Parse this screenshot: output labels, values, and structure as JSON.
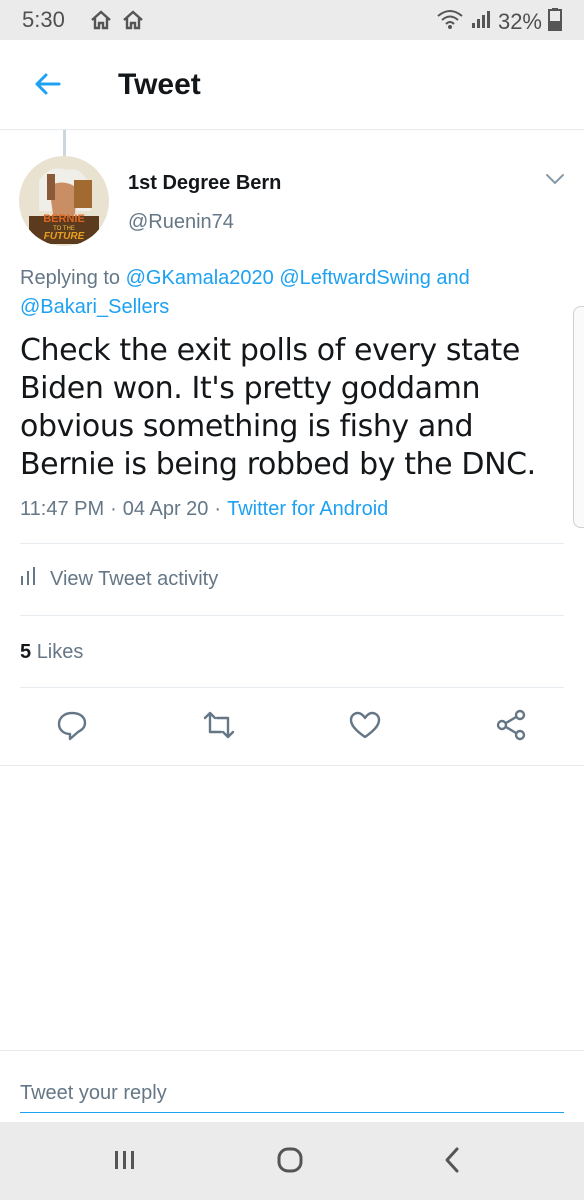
{
  "status_bar": {
    "time": "5:30",
    "battery": "32%",
    "icons": [
      "home-icon",
      "home-icon",
      "wifi-icon",
      "signal-icon",
      "battery-icon"
    ]
  },
  "header": {
    "title": "Tweet",
    "back_icon": "arrow-left-icon"
  },
  "tweet": {
    "author_name": "1st Degree Bern",
    "author_handle": "@Ruenin74",
    "avatar_text": [
      "BERNIE",
      "TO THE",
      "FUTURE"
    ],
    "replying_prefix": "Replying to",
    "replying_to": [
      "@GKamala2020",
      "@LeftwardSwing",
      "@Bakari_Sellers"
    ],
    "replying_and": "and",
    "text": "Check the exit polls of every state Biden won. It's pretty goddamn obvious something is fishy and Bernie is being robbed by the DNC.",
    "time": "11:47 PM",
    "date": "04 Apr 20",
    "client": "Twitter for Android",
    "separator": "·"
  },
  "activity": {
    "label": "View Tweet activity",
    "icon": "bar-chart-icon"
  },
  "likes": {
    "count": "5",
    "label": "Likes"
  },
  "actions": [
    "reply-icon",
    "retweet-icon",
    "like-icon",
    "share-icon"
  ],
  "reply": {
    "placeholder": "Tweet your reply"
  },
  "colors": {
    "accent": "#1da1f2",
    "secondary_text": "#657786",
    "primary_text": "#14171a"
  }
}
